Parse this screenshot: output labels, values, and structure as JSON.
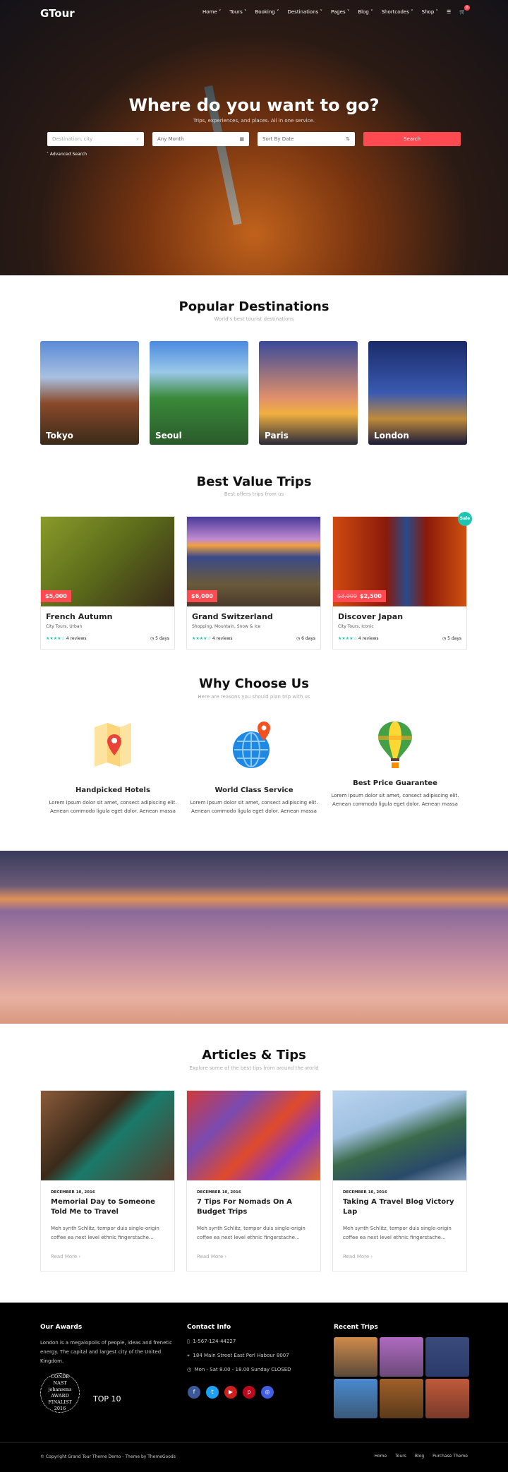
{
  "header": {
    "logo": "GTour",
    "nav": [
      "Home",
      "Tours",
      "Booking",
      "Destinations",
      "Pages",
      "Blog",
      "Shortcodes",
      "Shop"
    ],
    "cart_count": "0"
  },
  "hero": {
    "title": "Where do you want to go?",
    "subtitle": "Trips, experiences, and places. All in one service.",
    "destination_placeholder": "Destination, city",
    "month": "Any Month",
    "sort": "Sort By Date",
    "search_label": "Search",
    "advanced": "Advanced Search"
  },
  "destinations": {
    "title": "Popular Destinations",
    "subtitle": "World's best tourist destinations",
    "items": [
      {
        "name": "Tokyo"
      },
      {
        "name": "Seoul"
      },
      {
        "name": "Paris"
      },
      {
        "name": "London"
      }
    ]
  },
  "trips": {
    "title": "Best Value Trips",
    "subtitle": "Best offers trips from us",
    "sale_label": "Sale",
    "items": [
      {
        "name": "French Autumn",
        "price": "$5,000",
        "old_price": "",
        "categories": "City Tours, Urban",
        "rating": 4,
        "reviews": "4 reviews",
        "duration": "5 days"
      },
      {
        "name": "Grand Switzerland",
        "price": "$6,000",
        "old_price": "",
        "categories": "Shopping, Mountain, Snow & Ice",
        "rating": 4,
        "reviews": "4 reviews",
        "duration": "6 days"
      },
      {
        "name": "Discover Japan",
        "price": "$2,500",
        "old_price": "$3,000",
        "categories": "City Tours, Iconic",
        "rating": 4,
        "reviews": "4 reviews",
        "duration": "5 days"
      }
    ]
  },
  "why": {
    "title": "Why Choose Us",
    "subtitle": "Here are reasons you should plan trip with us",
    "items": [
      {
        "title": "Handpicked Hotels",
        "text": "Lorem ipsum dolor sit amet, consect adipiscing elit. Aenean commodo ligula eget dolor. Aenean massa",
        "icon": "map-pin-icon"
      },
      {
        "title": "World Class Service",
        "text": "Lorem ipsum dolor sit amet, consect adipiscing elit. Aenean commodo ligula eget dolor. Aenean massa",
        "icon": "globe-pin-icon"
      },
      {
        "title": "Best Price Guarantee",
        "text": "Lorem ipsum dolor sit amet, consect adipiscing elit. Aenean commodo ligula eget dolor. Aenean massa",
        "icon": "hot-air-balloon-icon"
      }
    ]
  },
  "articles": {
    "title": "Articles & Tips",
    "subtitle": "Explore some of the best tips from around the world",
    "read_more": "Read More",
    "items": [
      {
        "date": "DECEMBER 10, 2016",
        "title": "Memorial Day to Someone Told Me to Travel",
        "excerpt": "Meh synth Schlitz, tempor duis single-origin coffee ea next level ethnic fingerstache..."
      },
      {
        "date": "DECEMBER 10, 2016",
        "title": "7 Tips For Nomads On A Budget Trips",
        "excerpt": "Meh synth Schlitz, tempor duis single-origin coffee ea next level ethnic fingerstache..."
      },
      {
        "date": "DECEMBER 10, 2016",
        "title": "Taking A Travel Blog Victory Lap",
        "excerpt": "Meh synth Schlitz, tempor duis single-origin coffee ea next level ethnic fingerstache..."
      }
    ]
  },
  "footer": {
    "awards_title": "Our Awards",
    "awards_text": "London is a megalopolis of people, ideas and frenetic energy. The capital and largest city of the United Kingdom.",
    "award1": "CONDÉ NAST johansens AWARD FINALIST 2016",
    "award2": "TOP 10",
    "contact_title": "Contact Info",
    "phone": "1-567-124-44227",
    "address": "184 Main Street East Perl Habour 8007",
    "hours": "Mon - Sat 8.00 - 18.00 Sunday CLOSED",
    "recent_title": "Recent Trips",
    "copyright": "© Copyright Grand Tour Theme Demo - Theme by ThemeGoods",
    "links": [
      "Home",
      "Tours",
      "Blog",
      "Purchase Theme"
    ]
  },
  "colors": {
    "accent": "#ff4a52",
    "teal": "#20c4b0"
  }
}
